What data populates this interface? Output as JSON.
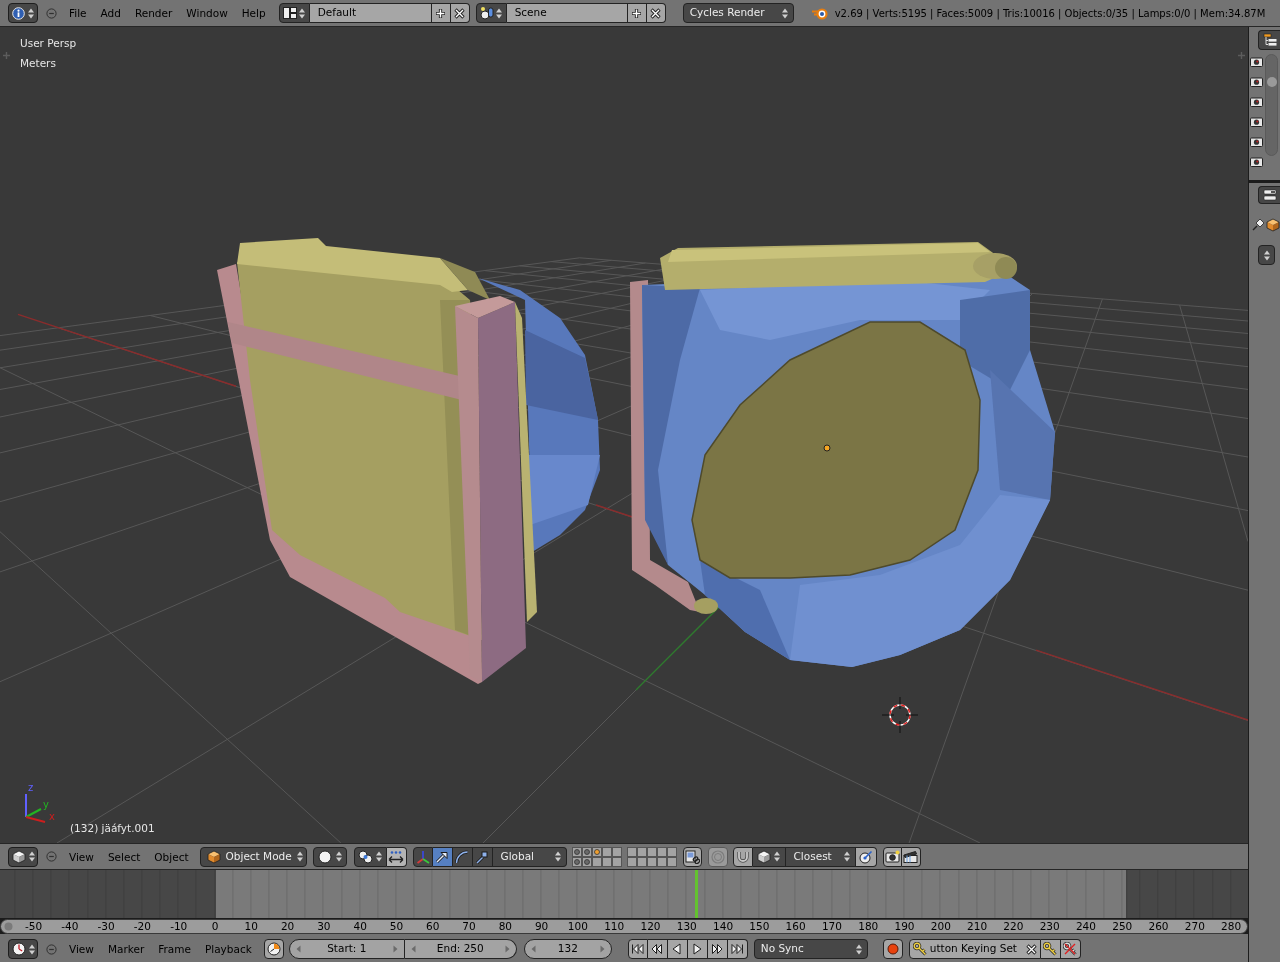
{
  "info_header": {
    "menus": [
      "File",
      "Add",
      "Render",
      "Window",
      "Help"
    ],
    "screen_layout": "Default",
    "scene": "Scene",
    "render_engine": "Cycles Render",
    "stats": "v2.69 | Verts:5195 | Faces:5009 | Tris:10016 | Objects:0/35 | Lamps:0/0 | Mem:34.87M"
  },
  "viewport": {
    "view_name": "User Persp",
    "units": "Meters",
    "object_info": "(132) jäáfyt.001",
    "axis_gizmo": [
      {
        "label": "z",
        "color": "#6060ff"
      },
      {
        "label": "y",
        "color": "#22b422"
      },
      {
        "label": "x",
        "color": "#cc1e1e"
      }
    ]
  },
  "view3d_header": {
    "menus": [
      "View",
      "Select",
      "Object"
    ],
    "mode": "Object Mode",
    "manipulators": [
      {
        "kind": "axes",
        "selected": false
      },
      {
        "kind": "translate",
        "selected": true
      },
      {
        "kind": "rotate",
        "selected": false
      },
      {
        "kind": "scale",
        "selected": false
      }
    ],
    "orientation": "Global",
    "layers": [
      {
        "kind": "used"
      },
      {
        "kind": "used"
      },
      {
        "kind": "active"
      },
      {
        "kind": "empty"
      },
      {
        "kind": "empty"
      },
      {
        "kind": "used"
      },
      {
        "kind": "used"
      },
      {
        "kind": "empty"
      },
      {
        "kind": "empty"
      },
      {
        "kind": "empty"
      },
      {
        "kind": "empty"
      },
      {
        "kind": "empty"
      },
      {
        "kind": "empty"
      },
      {
        "kind": "empty"
      },
      {
        "kind": "empty"
      },
      {
        "kind": "empty"
      },
      {
        "kind": "empty"
      },
      {
        "kind": "empty"
      },
      {
        "kind": "empty"
      },
      {
        "kind": "empty"
      }
    ],
    "snap_target": "Closest"
  },
  "timeline": {
    "ruler": [
      "-50",
      "-40",
      "-30",
      "-20",
      "-10",
      "0",
      "10",
      "20",
      "30",
      "40",
      "50",
      "60",
      "70",
      "80",
      "90",
      "100",
      "110",
      "120",
      "130",
      "140",
      "150",
      "160",
      "170",
      "180",
      "190",
      "200",
      "210",
      "220",
      "230",
      "240",
      "250",
      "260",
      "270",
      "280"
    ],
    "playhead": {
      "level": 0.557
    }
  },
  "timeline_header": {
    "menus": [
      "View",
      "Marker",
      "Frame",
      "Playback"
    ],
    "start": "Start: 1",
    "end": "End: 250",
    "current_frame": "132",
    "sync": "No Sync",
    "keying_set": "utton Keying Set"
  }
}
